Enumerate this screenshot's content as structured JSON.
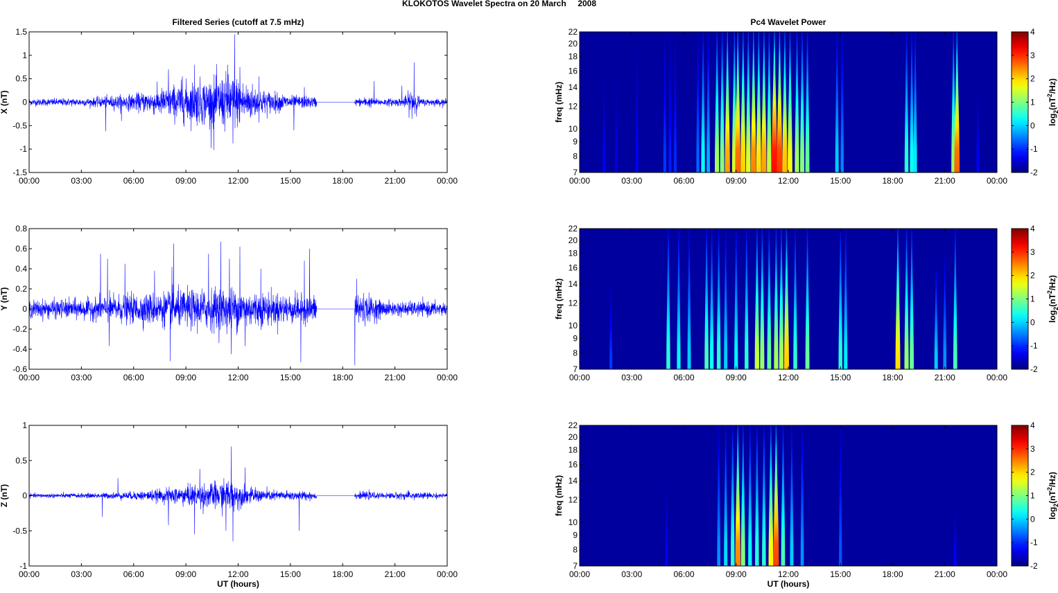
{
  "figure_title": "KLOKOTOS Wavelet Spectra on 20 March     2008",
  "chart_data": [
    {
      "type": "line",
      "title": "Filtered Series (cutoff at 7.5 mHz)",
      "ylabel": "X (nT)",
      "xlabel": "",
      "xlim": [
        0,
        24
      ],
      "ylim": [
        -1.5,
        1.5
      ],
      "xticks": [
        "00:00",
        "03:00",
        "06:00",
        "09:00",
        "12:00",
        "15:00",
        "18:00",
        "21:00",
        "00:00"
      ],
      "yticks": [
        -1.5,
        -1,
        -0.5,
        0,
        0.5,
        1,
        1.5
      ],
      "ytick_labels": [
        "-1.5",
        "-1",
        "-0.5",
        "0",
        "0.5",
        "1",
        "1.5"
      ],
      "color": "#0000ff",
      "data_gap_hours": [
        16.5,
        18.7
      ],
      "envelope": [
        [
          0,
          0.05
        ],
        [
          3.5,
          0.06
        ],
        [
          4.5,
          0.09
        ],
        [
          6,
          0.12
        ],
        [
          7.5,
          0.2
        ],
        [
          9,
          0.3
        ],
        [
          10.5,
          0.35
        ],
        [
          11.5,
          0.42
        ],
        [
          12.5,
          0.3
        ],
        [
          13.5,
          0.18
        ],
        [
          15,
          0.1
        ],
        [
          16.5,
          0.08
        ],
        [
          18.7,
          0.05
        ],
        [
          19.5,
          0.08
        ],
        [
          20,
          0.05
        ],
        [
          21.5,
          0.06
        ],
        [
          22,
          0.22
        ],
        [
          22.5,
          0.05
        ],
        [
          24,
          0.05
        ]
      ],
      "spikes": [
        [
          4.4,
          -0.62
        ],
        [
          5.3,
          -0.4
        ],
        [
          8,
          0.7
        ],
        [
          8.8,
          0.55
        ],
        [
          9.5,
          0.8
        ],
        [
          10.6,
          -1.02
        ],
        [
          11.4,
          0.8
        ],
        [
          11.8,
          1.45
        ],
        [
          12.1,
          0.75
        ],
        [
          11.7,
          -0.88
        ],
        [
          13.2,
          0.55
        ],
        [
          15.2,
          -0.6
        ],
        [
          15.8,
          0.32
        ],
        [
          19.8,
          0.45
        ],
        [
          22.1,
          0.85
        ],
        [
          22.1,
          -0.65
        ],
        [
          21.4,
          0.35
        ]
      ]
    },
    {
      "type": "line",
      "title": "",
      "ylabel": "Y (nT)",
      "xlabel": "",
      "xlim": [
        0,
        24
      ],
      "ylim": [
        -0.6,
        0.8
      ],
      "xticks": [
        "00:00",
        "03:00",
        "06:00",
        "09:00",
        "12:00",
        "15:00",
        "18:00",
        "21:00",
        "00:00"
      ],
      "yticks": [
        -0.6,
        -0.4,
        -0.2,
        0,
        0.2,
        0.4,
        0.6,
        0.8
      ],
      "ytick_labels": [
        "-0.6",
        "-0.4",
        "-0.2",
        "0",
        "0.2",
        "0.4",
        "0.6",
        "0.8"
      ],
      "color": "#0000ff",
      "data_gap_hours": [
        16.5,
        18.7
      ],
      "envelope": [
        [
          0,
          0.06
        ],
        [
          3.5,
          0.07
        ],
        [
          4.5,
          0.09
        ],
        [
          6,
          0.1
        ],
        [
          8,
          0.12
        ],
        [
          10,
          0.14
        ],
        [
          11.5,
          0.15
        ],
        [
          13,
          0.12
        ],
        [
          15,
          0.1
        ],
        [
          16.5,
          0.09
        ],
        [
          18.7,
          0.14
        ],
        [
          19.5,
          0.09
        ],
        [
          20.5,
          0.05
        ],
        [
          24,
          0.05
        ]
      ],
      "spikes": [
        [
          4.1,
          0.55
        ],
        [
          4.5,
          0.5
        ],
        [
          4.6,
          -0.37
        ],
        [
          5.5,
          0.45
        ],
        [
          7.2,
          0.38
        ],
        [
          8.2,
          0.42
        ],
        [
          8.3,
          0.65
        ],
        [
          8.1,
          -0.52
        ],
        [
          10.3,
          0.55
        ],
        [
          11,
          0.67
        ],
        [
          11.5,
          0.5
        ],
        [
          11.6,
          -0.45
        ],
        [
          12.1,
          0.62
        ],
        [
          12.4,
          -0.37
        ],
        [
          13.3,
          0.4
        ],
        [
          15.6,
          -0.53
        ],
        [
          15.8,
          0.48
        ],
        [
          16.1,
          0.6
        ],
        [
          18.7,
          -0.56
        ],
        [
          18.8,
          0.3
        ]
      ]
    },
    {
      "type": "line",
      "title": "",
      "ylabel": "Z (nT)",
      "xlabel": "UT (hours)",
      "xlim": [
        0,
        24
      ],
      "ylim": [
        -1,
        1
      ],
      "xticks": [
        "00:00",
        "03:00",
        "06:00",
        "09:00",
        "12:00",
        "15:00",
        "18:00",
        "21:00",
        "00:00"
      ],
      "yticks": [
        -1,
        -0.5,
        0,
        0.5,
        1
      ],
      "ytick_labels": [
        "-1",
        "-0.5",
        "0",
        "0.5",
        "1"
      ],
      "color": "#0000ff",
      "data_gap_hours": [
        16.5,
        18.7
      ],
      "envelope": [
        [
          0,
          0.02
        ],
        [
          4,
          0.025
        ],
        [
          6,
          0.04
        ],
        [
          7.5,
          0.06
        ],
        [
          9,
          0.1
        ],
        [
          10.5,
          0.13
        ],
        [
          11.5,
          0.16
        ],
        [
          12.5,
          0.08
        ],
        [
          14,
          0.05
        ],
        [
          16.5,
          0.04
        ],
        [
          18.7,
          0.03
        ],
        [
          19.5,
          0.04
        ],
        [
          20,
          0.025
        ],
        [
          22,
          0.04
        ],
        [
          24,
          0.02
        ]
      ],
      "spikes": [
        [
          5.1,
          0.25
        ],
        [
          4.2,
          -0.3
        ],
        [
          8,
          -0.42
        ],
        [
          9.5,
          -0.55
        ],
        [
          9.8,
          0.38
        ],
        [
          11.3,
          -0.5
        ],
        [
          11.6,
          0.7
        ],
        [
          11.7,
          -0.65
        ],
        [
          12.4,
          0.4
        ],
        [
          15.5,
          -0.5
        ]
      ]
    },
    {
      "type": "heatmap",
      "title": "Pc4 Wavelet Power",
      "ylabel": "freq (mHz)",
      "xlabel": "",
      "xlim": [
        0,
        24
      ],
      "ylim": [
        7,
        22
      ],
      "yscale": "log",
      "yticks": [
        "7",
        "8",
        "9",
        "10",
        "12",
        "14",
        "16",
        "18",
        "20",
        "22"
      ],
      "xticks": [
        "00:00",
        "03:00",
        "06:00",
        "09:00",
        "12:00",
        "15:00",
        "18:00",
        "21:00",
        "00:00"
      ],
      "colorbar": {
        "range": [
          -2,
          4
        ],
        "ticks": [
          "-2",
          "-1",
          "0",
          "1",
          "2",
          "3",
          "4"
        ],
        "label_parts": [
          "log",
          "2",
          "(nT",
          "2",
          "/Hz)"
        ]
      },
      "bursts_hour_topfreq_peaklog2": [
        [
          1.4,
          16,
          -1.2
        ],
        [
          2.1,
          18,
          -1.4
        ],
        [
          3.3,
          21,
          -1.2
        ],
        [
          4.9,
          22,
          -0.8
        ],
        [
          5.2,
          22,
          -1
        ],
        [
          5.5,
          22,
          -0.9
        ],
        [
          6.8,
          22,
          -0.5
        ],
        [
          7.1,
          22,
          0.6
        ],
        [
          7.4,
          22,
          0
        ],
        [
          7.9,
          22,
          1.6
        ],
        [
          8.2,
          22,
          1.4
        ],
        [
          8.5,
          22,
          2.8
        ],
        [
          8.9,
          22,
          2
        ],
        [
          9.1,
          22,
          3.2
        ],
        [
          9.4,
          22,
          2.5
        ],
        [
          9.7,
          22,
          2
        ],
        [
          10.0,
          22,
          3
        ],
        [
          10.3,
          22,
          2.4
        ],
        [
          10.6,
          22,
          2.8
        ],
        [
          10.9,
          22,
          1.8
        ],
        [
          11.2,
          22,
          3.8
        ],
        [
          11.5,
          22,
          3.5
        ],
        [
          11.8,
          22,
          2.6
        ],
        [
          12.1,
          22,
          2.2
        ],
        [
          12.5,
          22,
          1.6
        ],
        [
          12.8,
          22,
          1.4
        ],
        [
          13.1,
          22,
          1.2
        ],
        [
          14.8,
          22,
          0.2
        ],
        [
          15.1,
          22,
          -0.3
        ],
        [
          18.8,
          22,
          0.8
        ],
        [
          19.1,
          22,
          0.6
        ],
        [
          19.3,
          22,
          0.4
        ],
        [
          21.5,
          22,
          1.5
        ],
        [
          21.7,
          22,
          3.2
        ],
        [
          22.9,
          15,
          -1.2
        ]
      ]
    },
    {
      "type": "heatmap",
      "title": "",
      "ylabel": "freq (mHz)",
      "xlabel": "",
      "xlim": [
        0,
        24
      ],
      "ylim": [
        7,
        22
      ],
      "yscale": "log",
      "yticks": [
        "7",
        "8",
        "9",
        "10",
        "12",
        "14",
        "16",
        "18",
        "20",
        "22"
      ],
      "xticks": [
        "00:00",
        "03:00",
        "06:00",
        "09:00",
        "12:00",
        "15:00",
        "18:00",
        "21:00",
        "00:00"
      ],
      "colorbar": {
        "range": [
          -2,
          4
        ],
        "ticks": [
          "-2",
          "-1",
          "0",
          "1",
          "2",
          "3",
          "4"
        ],
        "label_parts": [
          "log",
          "2",
          "(nT",
          "2",
          "/Hz)"
        ]
      },
      "bursts_hour_topfreq_peaklog2": [
        [
          1.8,
          14,
          -0.8
        ],
        [
          5.1,
          22,
          0.8
        ],
        [
          5.7,
          22,
          0.5
        ],
        [
          6.3,
          22,
          0.2
        ],
        [
          7.3,
          22,
          1
        ],
        [
          7.6,
          22,
          0.6
        ],
        [
          8.0,
          22,
          0.8
        ],
        [
          8.4,
          22,
          0.2
        ],
        [
          9.0,
          22,
          0.5
        ],
        [
          9.6,
          22,
          0.8
        ],
        [
          10.2,
          22,
          1.8
        ],
        [
          10.5,
          22,
          1.5
        ],
        [
          10.9,
          22,
          1.2
        ],
        [
          11.3,
          22,
          1.6
        ],
        [
          11.6,
          22,
          1.6
        ],
        [
          11.9,
          22,
          2.5
        ],
        [
          12.4,
          22,
          0.8
        ],
        [
          13.1,
          22,
          1.2
        ],
        [
          15.0,
          22,
          0.8
        ],
        [
          15.3,
          22,
          0.4
        ],
        [
          18.3,
          22,
          2.4
        ],
        [
          18.8,
          22,
          1.5
        ],
        [
          19.1,
          22,
          1.2
        ],
        [
          20.5,
          16,
          0.2
        ],
        [
          21.0,
          18,
          -0.2
        ],
        [
          21.6,
          22,
          1
        ]
      ]
    },
    {
      "type": "heatmap",
      "title": "",
      "ylabel": "freq (mHz)",
      "xlabel": "UT (hours)",
      "xlim": [
        0,
        24
      ],
      "ylim": [
        7,
        22
      ],
      "yscale": "log",
      "yticks": [
        "7",
        "8",
        "9",
        "10",
        "12",
        "14",
        "16",
        "18",
        "20",
        "22"
      ],
      "xticks": [
        "00:00",
        "03:00",
        "06:00",
        "09:00",
        "12:00",
        "15:00",
        "18:00",
        "21:00",
        "00:00"
      ],
      "colorbar": {
        "range": [
          -2,
          4
        ],
        "ticks": [
          "-2",
          "-1",
          "0",
          "1",
          "2",
          "3",
          "4"
        ],
        "label_parts": [
          "log",
          "2",
          "(nT",
          "2",
          "/Hz)"
        ]
      },
      "bursts_hour_topfreq_peaklog2": [
        [
          5.0,
          14,
          -1.2
        ],
        [
          8.0,
          22,
          -0.2
        ],
        [
          8.4,
          22,
          0.3
        ],
        [
          8.8,
          22,
          0.8
        ],
        [
          9.1,
          22,
          3
        ],
        [
          9.4,
          22,
          1.4
        ],
        [
          9.8,
          22,
          0.6
        ],
        [
          10.2,
          22,
          0.8
        ],
        [
          10.6,
          22,
          0.8
        ],
        [
          11.0,
          22,
          2.2
        ],
        [
          11.3,
          22,
          3.4
        ],
        [
          11.7,
          22,
          1
        ],
        [
          12.2,
          22,
          0.2
        ],
        [
          12.8,
          22,
          -0.2
        ],
        [
          15.0,
          22,
          -0.6
        ],
        [
          21.6,
          12,
          -1.2
        ]
      ]
    }
  ]
}
